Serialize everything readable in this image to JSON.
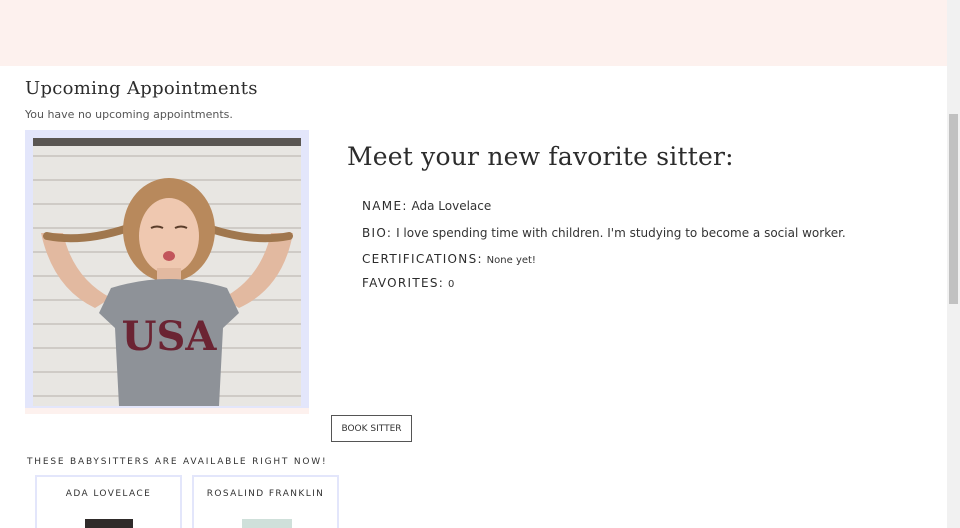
{
  "appointments": {
    "heading": "Upcoming Appointments",
    "empty_message": "You have no upcoming appointments."
  },
  "featured_sitter": {
    "title": "Meet your new favorite sitter:",
    "name_label": "NAME:",
    "name": "Ada Lovelace",
    "bio_label": "BIO:",
    "bio": "I love spending time with children. I'm studying to become a social worker.",
    "certifications_label": "CERTIFICATIONS:",
    "certifications": "None yet!",
    "favorites_label": "FAVORITES:",
    "favorites": "0",
    "photo_shirt_text": "USA"
  },
  "actions": {
    "book_label": "BOOK SITTER"
  },
  "available": {
    "heading": "THESE BABYSITTERS ARE AVAILABLE RIGHT NOW!",
    "sitters": [
      {
        "name": "ADA LOVELACE"
      },
      {
        "name": "ROSALIND FRANKLIN"
      }
    ]
  },
  "colors": {
    "banner": "#fdf1ee",
    "accent_blue": "#e3e6fb"
  }
}
